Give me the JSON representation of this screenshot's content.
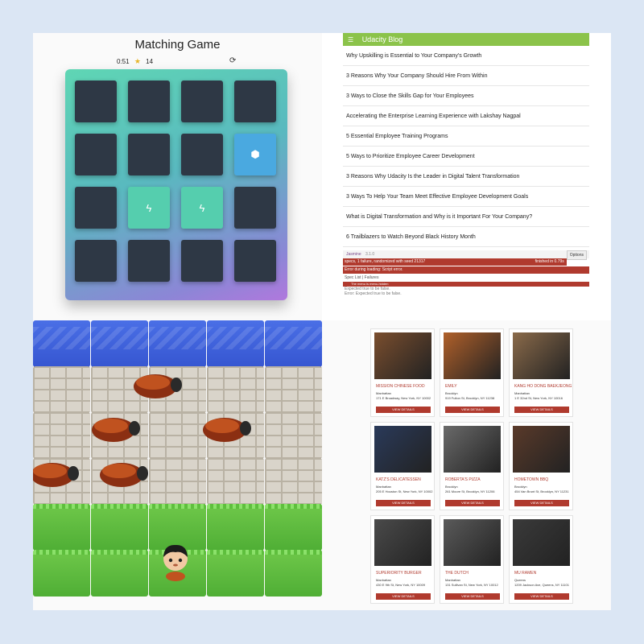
{
  "game": {
    "title": "Matching Game",
    "timer": "0:51",
    "moves": "14",
    "cards": [
      {
        "state": "closed",
        "icon": ""
      },
      {
        "state": "closed",
        "icon": ""
      },
      {
        "state": "closed",
        "icon": ""
      },
      {
        "state": "closed",
        "icon": ""
      },
      {
        "state": "closed",
        "icon": ""
      },
      {
        "state": "closed",
        "icon": ""
      },
      {
        "state": "closed",
        "icon": ""
      },
      {
        "state": "open",
        "icon": "cube-icon"
      },
      {
        "state": "closed",
        "icon": ""
      },
      {
        "state": "match",
        "icon": "bolt-icon"
      },
      {
        "state": "match",
        "icon": "bolt-icon"
      },
      {
        "state": "closed",
        "icon": ""
      },
      {
        "state": "closed",
        "icon": ""
      },
      {
        "state": "closed",
        "icon": ""
      },
      {
        "state": "closed",
        "icon": ""
      },
      {
        "state": "closed",
        "icon": ""
      }
    ]
  },
  "blog": {
    "header": "Udacity Blog",
    "items": [
      "Why Upskilling is Essential to Your Company's Growth",
      "3 Reasons Why Your Company Should Hire From Within",
      "3 Ways to Close the Skills Gap for Your Employees",
      "Accelerating the Enterprise Learning Experience with Lakshay Nagpal",
      "5 Essential Employee Training Programs",
      "5 Ways to Prioritize Employee Career Development",
      "3 Reasons Why Udacity Is the Leader in Digital Talent Transformation",
      "3 Ways To Help Your Team Meet Effective Employee Development Goals",
      "What is Digital Transformation and Why is it Important For Your Company?",
      "6 Trailblazers to Watch Beyond Black History Month"
    ],
    "jasmine": {
      "brand": "Jasmine",
      "version": "3.1.0",
      "options_button": "Options",
      "summary": "specs, 1 failure, randomized with seed 21317",
      "finished": "finished in 0.79s",
      "error": "Error during loading: Script error.",
      "spec_list": "Spec List",
      "failures": "Failures",
      "failed_spec": "The menu is menu-hidden",
      "expected": "Expected true to be false.",
      "stack": "Error: Expected true to be false."
    }
  },
  "restaurants": [
    {
      "name": "MISSION CHINESE FOOD",
      "neighborhood": "Manhattan",
      "address": "171 E Broadway, New York, NY 10002",
      "button": "VIEW DETAILS",
      "photo_color": "#7a4e2e"
    },
    {
      "name": "EMILY",
      "neighborhood": "Brooklyn",
      "address": "919 Fulton St, Brooklyn, NY 11238",
      "button": "VIEW DETAILS",
      "photo_color": "#b0602a"
    },
    {
      "name": "KANG HO DONG BAEKJEONG",
      "neighborhood": "Manhattan",
      "address": "1 E 32nd St, New York, NY 10016",
      "button": "VIEW DETAILS",
      "photo_color": "#8a6a4a"
    },
    {
      "name": "KATZ'S DELICATESSEN",
      "neighborhood": "Manhattan",
      "address": "205 E Houston St, New York, NY 10002",
      "button": "VIEW DETAILS",
      "photo_color": "#2a3a5a"
    },
    {
      "name": "ROBERTA'S PIZZA",
      "neighborhood": "Brooklyn",
      "address": "261 Moore St, Brooklyn, NY 11206",
      "button": "VIEW DETAILS",
      "photo_color": "#6a6a6a"
    },
    {
      "name": "HOMETOWN BBQ",
      "neighborhood": "Brooklyn",
      "address": "454 Van Brunt St, Brooklyn, NY 11231",
      "button": "VIEW DETAILS",
      "photo_color": "#5a3a2a"
    },
    {
      "name": "SUPERIORITY BURGER",
      "neighborhood": "Manhattan",
      "address": "430 E 9th St, New York, NY 10009",
      "button": "VIEW DETAILS",
      "photo_color": "#4a4a4a"
    },
    {
      "name": "THE DUTCH",
      "neighborhood": "Manhattan",
      "address": "131 Sullivan St, New York, NY 10012",
      "button": "VIEW DETAILS",
      "photo_color": "#5a5a5a"
    },
    {
      "name": "MU RAMEN",
      "neighborhood": "Queens",
      "address": "1209 Jackson Ave, Queens, NY 11101",
      "button": "VIEW DETAILS",
      "photo_color": "#3a3a3a"
    }
  ]
}
